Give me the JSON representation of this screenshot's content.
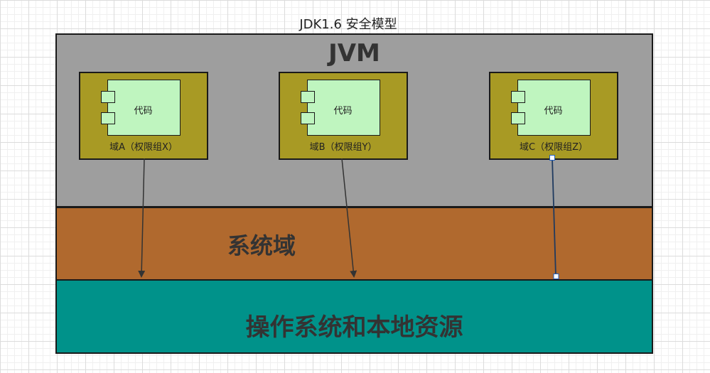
{
  "title": "JDK1.6 安全模型",
  "layers": {
    "jvm": "JVM",
    "system_domain": "系统域",
    "os": "操作系统和本地资源"
  },
  "domains": [
    {
      "component": "代码",
      "label": "域A（权限组X）"
    },
    {
      "component": "代码",
      "label": "域B（权限组Y）"
    },
    {
      "component": "代码",
      "label": "域C（权限组Z）"
    }
  ],
  "colors": {
    "jvm": "#9e9e9e",
    "system_domain": "#b0692e",
    "os": "#00928a",
    "domain": "#a89a24",
    "component": "#bff5bf"
  }
}
